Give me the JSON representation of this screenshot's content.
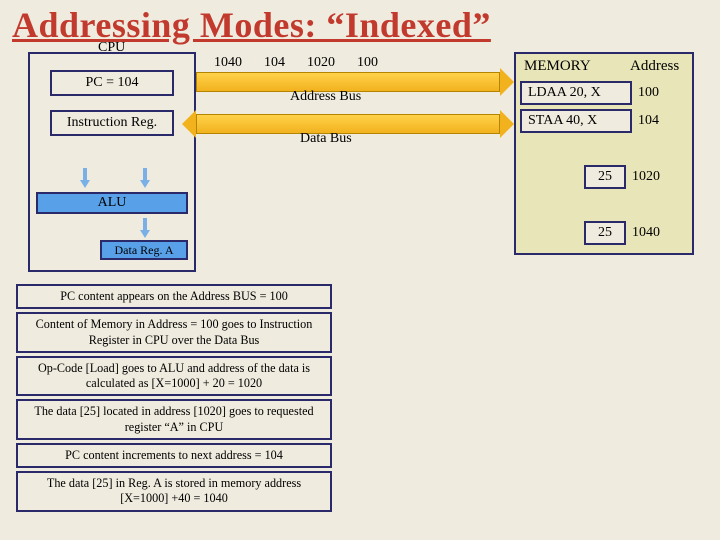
{
  "title": "Addressing Modes: “Indexed”",
  "cpu": {
    "label": "CPU",
    "pc": "PC = 104",
    "ir": "Instruction Reg.",
    "alu": "ALU",
    "drega": "Data Reg. A"
  },
  "buses": {
    "address_label": "Address Bus",
    "data_label": "Data Bus",
    "addr_values": [
      "1040",
      "104",
      "1020",
      "100"
    ]
  },
  "memory": {
    "header_left": "MEMORY",
    "header_right": "Address",
    "rows": [
      {
        "content": "LDAA  20, X",
        "addr": "100"
      },
      {
        "content": "STAA  40, X",
        "addr": "104"
      }
    ],
    "value_rows": [
      {
        "value": "25",
        "addr": "1020"
      },
      {
        "value": "25",
        "addr": "1040"
      }
    ]
  },
  "steps": [
    "PC content appears on the Address BUS = 100",
    "Content  of Memory in Address = 100 goes to Instruction Register in CPU over the Data Bus",
    "Op-Code [Load] goes to ALU and address of the data is calculated as [X=1000] + 20 = 1020",
    "The data [25] located in address [1020] goes to requested register “A” in CPU",
    "PC content increments to next address = 104",
    "The data [25] in Reg. A is stored in memory address [X=1000] +40 = 1040"
  ]
}
